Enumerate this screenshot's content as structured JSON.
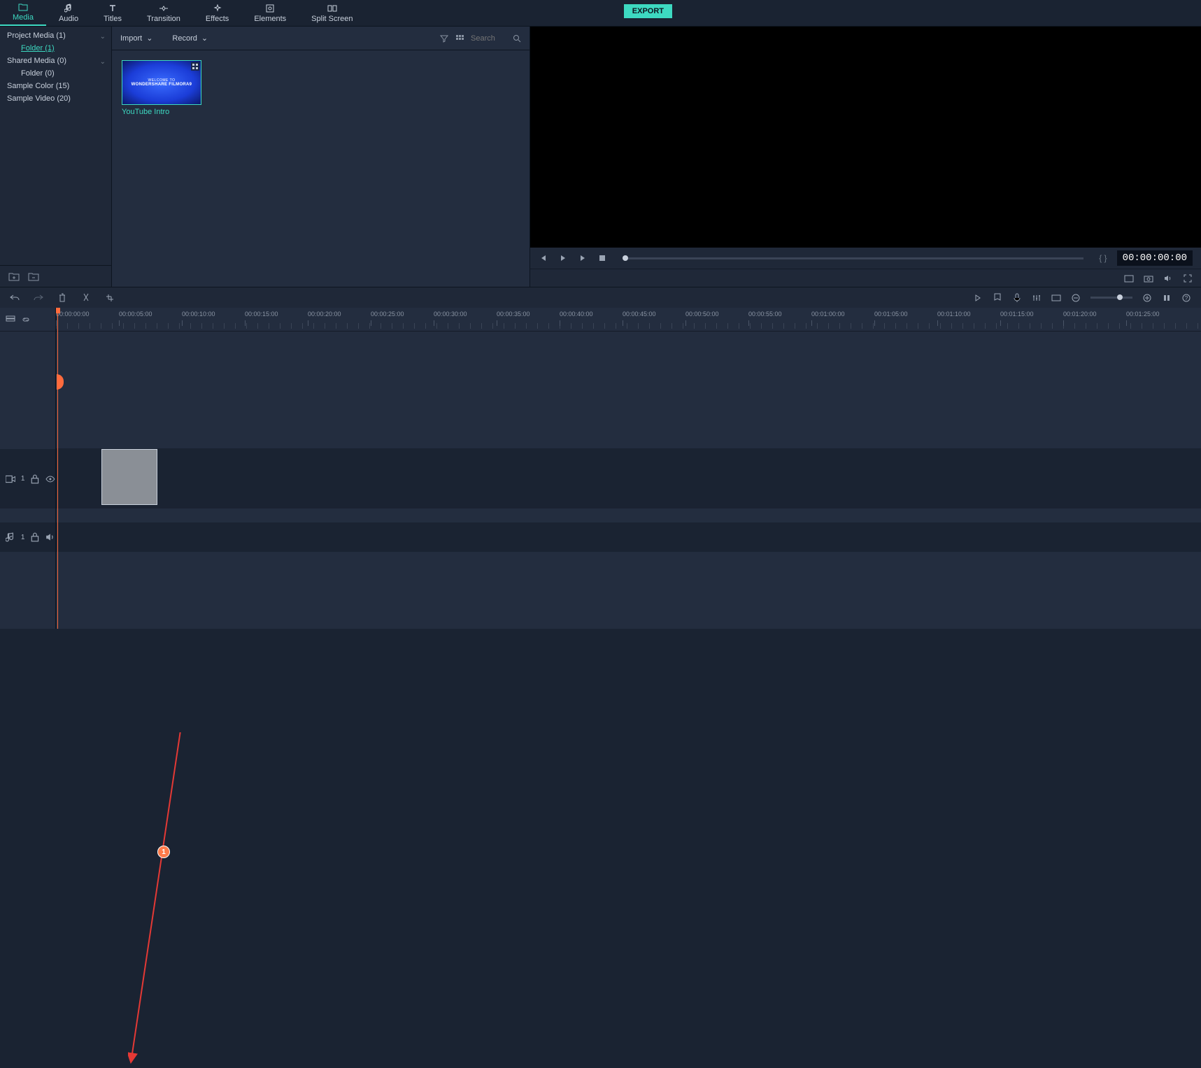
{
  "tabs": {
    "media": "Media",
    "audio": "Audio",
    "titles": "Titles",
    "transition": "Transition",
    "effects": "Effects",
    "elements": "Elements",
    "splitscreen": "Split Screen"
  },
  "export_label": "EXPORT",
  "sidebar": {
    "items": [
      {
        "label": "Project Media (1)",
        "expandable": true
      },
      {
        "label": "Folder (1)",
        "nested": true,
        "selected": true
      },
      {
        "label": "Shared Media (0)",
        "expandable": true
      },
      {
        "label": "Folder (0)",
        "nested": true
      },
      {
        "label": "Sample Color (15)"
      },
      {
        "label": "Sample Video (20)"
      }
    ]
  },
  "media_toolbar": {
    "import": "Import",
    "record": "Record",
    "search_placeholder": "Search"
  },
  "thumbnail": {
    "welcome": "WELCOME TO",
    "brand": "WONDERSHARE FILMORA9",
    "label": "YouTube Intro"
  },
  "preview": {
    "timecode": "00:00:00:00",
    "braces": "{   }"
  },
  "timeline": {
    "ticks": [
      "00:00:00:00",
      "00:00:05:00",
      "00:00:10:00",
      "00:00:15:00",
      "00:00:20:00",
      "00:00:25:00",
      "00:00:30:00",
      "00:00:35:00",
      "00:00:40:00",
      "00:00:45:00",
      "00:00:50:00",
      "00:00:55:00",
      "00:01:00:00",
      "00:01:05:00",
      "00:01:10:00",
      "00:01:15:00",
      "00:01:20:00",
      "00:01:25:00"
    ],
    "video_track": "1",
    "audio_track": "1"
  },
  "annotation": {
    "badge": "1"
  }
}
